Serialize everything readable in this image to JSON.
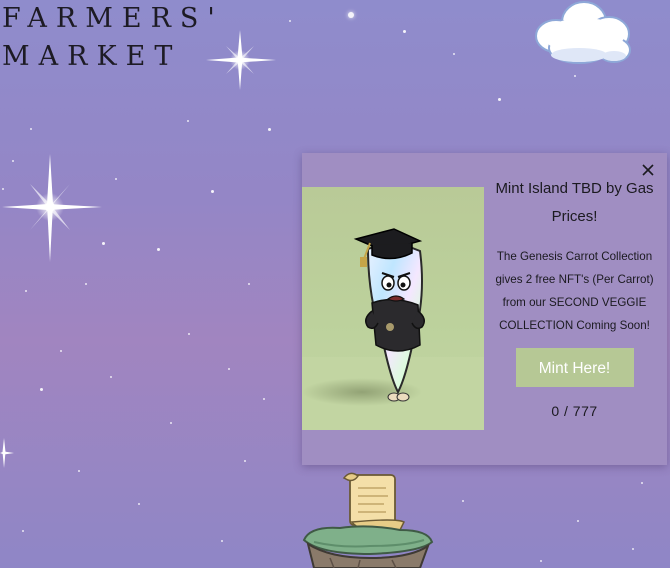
{
  "brand": {
    "line1": "FARMERS'",
    "line2": "MARKET"
  },
  "modal": {
    "title": "Mint Island TBD by Gas Prices!",
    "description": "The Genesis Carrot Collection gives 2 free NFT's (Per Carrot) from our SECOND VEGGIE COLLECTION Coming Soon!",
    "mint_button_label": "Mint Here!",
    "mint_counter": "0 / 777",
    "close_icon": "close-icon"
  },
  "colors": {
    "background_top": "#8f8ccc",
    "background_mid": "#a185c0",
    "modal_background": "#a08ec2",
    "mint_button": "#b6c895",
    "image_background": "#bcd19c"
  },
  "icons": [
    "sparkle-icon",
    "cloud",
    "carrot-graduate",
    "scroll-icon",
    "floating-island"
  ]
}
